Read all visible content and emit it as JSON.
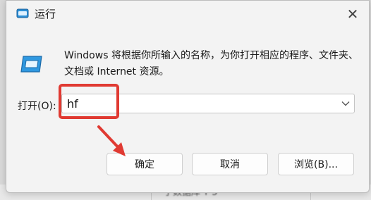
{
  "window": {
    "title": "运行",
    "close_icon": "close-icon"
  },
  "body": {
    "description": "Windows 将根据你所输入的名称，为你打开相应的程序、文件夹、文档或 Internet 资源。"
  },
  "open_field": {
    "label": "打开(O):",
    "value": "hf"
  },
  "buttons": {
    "ok": "确定",
    "cancel": "取消",
    "browse": "浏览(B)..."
  },
  "background": {
    "text": "于数据库 T 5"
  },
  "annotation": {
    "color": "#e03a32"
  }
}
